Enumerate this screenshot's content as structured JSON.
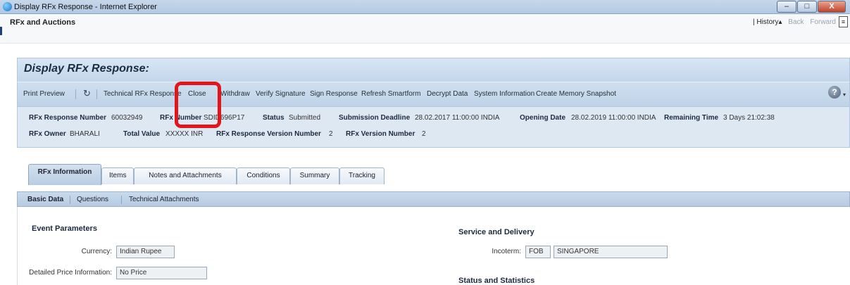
{
  "window": {
    "title": "Display RFx Response - Internet Explorer",
    "minimize": "–",
    "maximize": "□",
    "close": "X"
  },
  "app": {
    "title": "RFx and Auctions",
    "nav_separator": "|",
    "history": "History",
    "back": "Back",
    "forward": "Forward"
  },
  "page": {
    "title": "Display RFx Response:"
  },
  "toolbar": {
    "print_preview": "Print Preview",
    "refresh_symbol": "↻",
    "technical_rfx_response": "Technical RFx Response",
    "close": "Close",
    "withdraw": "Withdraw",
    "verify_signature": "Verify Signature",
    "sign_response": "Sign Response",
    "refresh_smartform": "Refresh Smartform",
    "decrypt_data": "Decrypt Data",
    "system_information": "System Information",
    "create_memory_snapshot": "Create Memory Snapshot",
    "help_symbol": "?"
  },
  "header": {
    "response_number_label": "RFx Response Number",
    "response_number": "60032949",
    "rfx_number_label": "RFx Number",
    "rfx_number": "SDID696P17",
    "status_label": "Status",
    "status": "Submitted",
    "submission_deadline_label": "Submission Deadline",
    "submission_deadline": "28.02.2017 11:00:00 INDIA",
    "opening_date_label": "Opening Date",
    "opening_date": "28.02.2019 11:00:00 INDIA",
    "remaining_time_label": "Remaining Time",
    "remaining_time": "3 Days 21:02:38",
    "owner_label": "RFx Owner",
    "owner": "BHARALI",
    "total_value_label": "Total Value",
    "total_value": "XXXXX INR",
    "response_version_label": "RFx Response Version Number",
    "response_version": "2",
    "rfx_version_label": "RFx Version Number",
    "rfx_version": "2"
  },
  "tabs": [
    {
      "label": "RFx Information",
      "active": true
    },
    {
      "label": "Items"
    },
    {
      "label": "Notes and Attachments"
    },
    {
      "label": "Conditions"
    },
    {
      "label": "Summary"
    },
    {
      "label": "Tracking"
    }
  ],
  "subtabs": [
    {
      "label": "Basic Data",
      "active": true
    },
    {
      "label": "Questions"
    },
    {
      "label": "Technical Attachments"
    }
  ],
  "event_parameters": {
    "title": "Event Parameters",
    "currency_label": "Currency:",
    "currency": "Indian Rupee",
    "price_info_label": "Detailed Price Information:",
    "price_info": "No Price"
  },
  "service_delivery": {
    "title": "Service and Delivery",
    "incoterm_label": "Incoterm:",
    "incoterm_code": "FOB",
    "incoterm_location": "SINGAPORE"
  },
  "status_statistics": {
    "title": "Status and Statistics"
  },
  "colors": {
    "highlight": "#e2141c",
    "toolbar": "#c7d9ec",
    "panel": "#dde8f3"
  }
}
